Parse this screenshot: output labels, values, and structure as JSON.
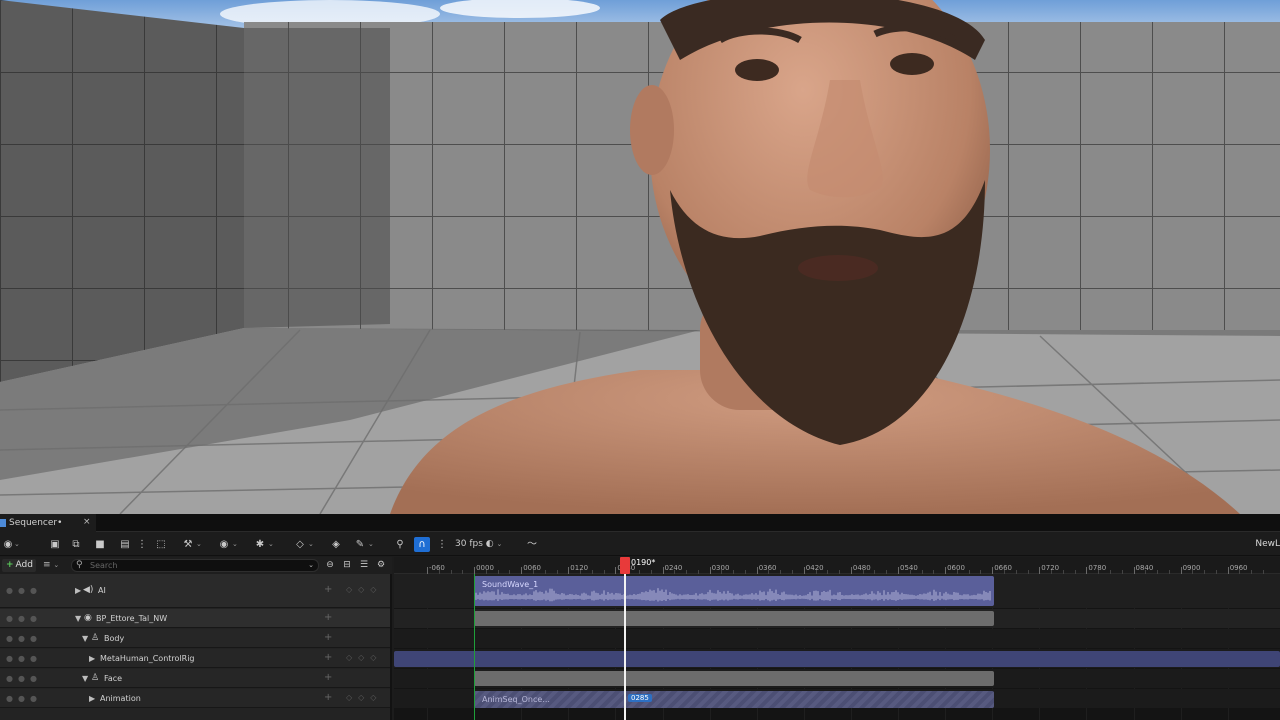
{
  "panel": {
    "tab_title": "Sequencer",
    "tab_modified": "•",
    "close": "×"
  },
  "toolbar": {
    "fps": "30 fps",
    "right_label": "NewL"
  },
  "outliner": {
    "add_label": "Add",
    "search_placeholder": "Search",
    "tracks": [
      {
        "label": "AI"
      },
      {
        "label": "BP_Ettore_Tal_NW"
      },
      {
        "label": "Body"
      },
      {
        "label": "MetaHuman_ControlRig"
      },
      {
        "label": "Face"
      },
      {
        "label": "Animation"
      }
    ]
  },
  "timeline": {
    "ticks": [
      "-060",
      "0000",
      "0060",
      "0120",
      "0180",
      "0240",
      "0300",
      "0360",
      "0420",
      "0480",
      "0540",
      "0600",
      "0660",
      "0720",
      "0780",
      "0840",
      "0900",
      "0960"
    ],
    "current_frame": "0190",
    "current_frame_marker": "*",
    "sections": {
      "audio": "SoundWave_1",
      "animation": "AnimSeq_Once...",
      "animation_badge": "0285"
    }
  },
  "colors": {
    "audio_section": "#5a5f9a",
    "controlrig_section": "#3f4576",
    "animation_section": "#575a80",
    "playhead": "#e83a3a",
    "snap_active": "#1f6ed4"
  }
}
